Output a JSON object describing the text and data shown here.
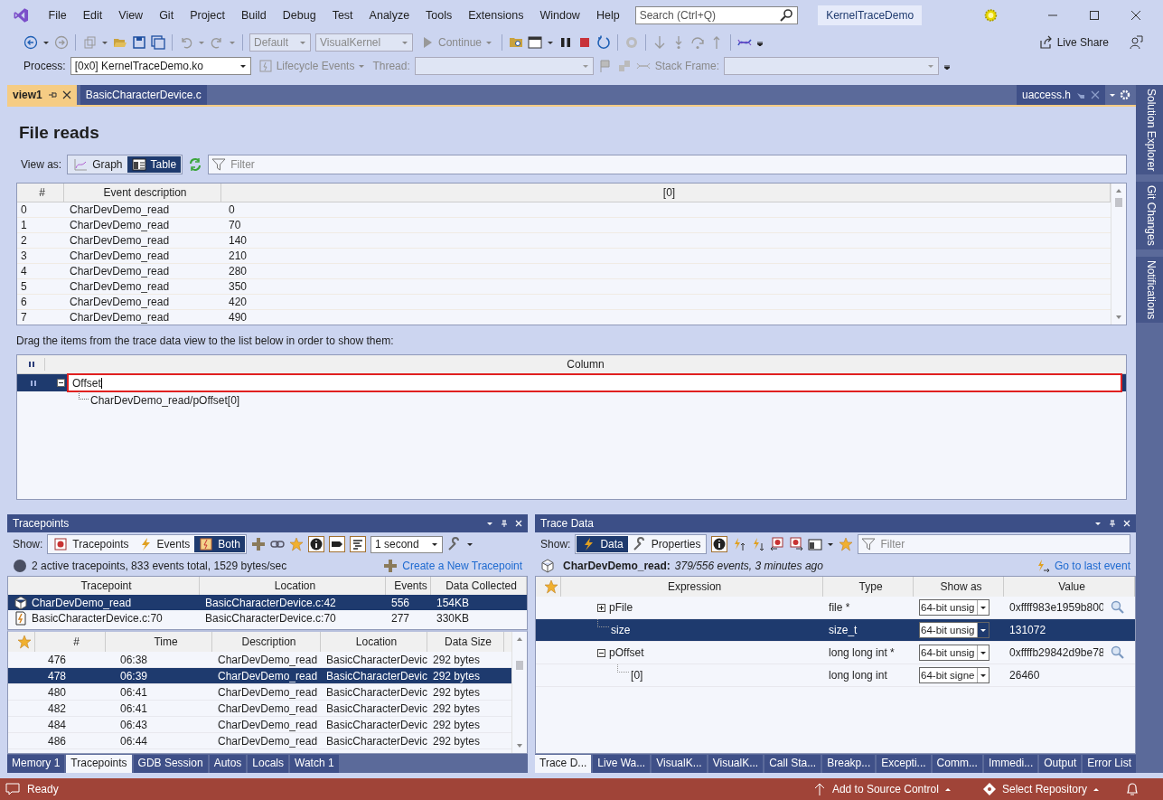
{
  "menu": [
    "File",
    "Edit",
    "View",
    "Git",
    "Project",
    "Build",
    "Debug",
    "Test",
    "Analyze",
    "Tools",
    "Extensions",
    "Window",
    "Help"
  ],
  "search": {
    "placeholder": "Search (Ctrl+Q)"
  },
  "solution_name": "KernelTraceDemo",
  "toolbar": {
    "config": "Default",
    "platform": "VisualKernel",
    "continue": "Continue",
    "live_share": "Live Share"
  },
  "debug_bar": {
    "process_label": "Process:",
    "process": "[0x0] KernelTraceDemo.ko",
    "lifecycle": "Lifecycle Events",
    "thread_label": "Thread:",
    "stack_label": "Stack Frame:"
  },
  "doc_tabs": [
    {
      "label": "view1",
      "selected": true
    },
    {
      "label": "BasicCharacterDevice.c",
      "selected": false
    }
  ],
  "right_tab": "uaccess.h",
  "side_tabs": [
    "Solution Explorer",
    "Git Changes",
    "Notifications"
  ],
  "view": {
    "title": "File reads",
    "view_as_label": "View as:",
    "modes": [
      {
        "label": "Graph",
        "selected": false
      },
      {
        "label": "Table",
        "selected": true
      }
    ],
    "filter_placeholder": "Filter",
    "table": {
      "columns": [
        "#",
        "Event description",
        "[0]"
      ],
      "rows": [
        [
          "0",
          "CharDevDemo_read",
          "0"
        ],
        [
          "1",
          "CharDevDemo_read",
          "70"
        ],
        [
          "2",
          "CharDevDemo_read",
          "140"
        ],
        [
          "3",
          "CharDevDemo_read",
          "210"
        ],
        [
          "4",
          "CharDevDemo_read",
          "280"
        ],
        [
          "5",
          "CharDevDemo_read",
          "350"
        ],
        [
          "6",
          "CharDevDemo_read",
          "420"
        ],
        [
          "7",
          "CharDevDemo_read",
          "490"
        ]
      ]
    },
    "hint": "Drag the items from the trace data view to the list below in order to show them:",
    "column_list": {
      "header": "Column",
      "items": [
        {
          "name": "Offset",
          "expanded": true,
          "children": [
            {
              "name": "CharDevDemo_read/pOffset[0]"
            }
          ]
        }
      ]
    }
  },
  "tracepoints": {
    "title": "Tracepoints",
    "show_label": "Show:",
    "filters": [
      {
        "label": "Tracepoints",
        "selected": false
      },
      {
        "label": "Events",
        "selected": false
      },
      {
        "label": "Both",
        "selected": true
      }
    ],
    "interval": "1 second",
    "summary": "2 active tracepoints, 833 events total, 1529 bytes/sec",
    "create_link": "Create a New Tracepoint",
    "columns": [
      "Tracepoint",
      "Location",
      "Events",
      "Data Collected"
    ],
    "rows": [
      {
        "kind": "function",
        "selected": true,
        "cells": [
          "CharDevDemo_read",
          "BasicCharacterDevice.c:42",
          "556",
          "154KB"
        ]
      },
      {
        "kind": "line",
        "selected": false,
        "cells": [
          "BasicCharacterDevice.c:70",
          "BasicCharacterDevice.c:70",
          "277",
          "330KB"
        ]
      }
    ],
    "events": {
      "columns": [
        "#",
        "Time",
        "Description",
        "Location",
        "Data Size"
      ],
      "rows": [
        {
          "selected": false,
          "cells": [
            "476",
            "06:38",
            "CharDevDemo_read",
            "BasicCharacterDevic",
            "292 bytes"
          ]
        },
        {
          "selected": true,
          "cells": [
            "478",
            "06:39",
            "CharDevDemo_read",
            "BasicCharacterDevic",
            "292 bytes"
          ]
        },
        {
          "selected": false,
          "cells": [
            "480",
            "06:41",
            "CharDevDemo_read",
            "BasicCharacterDevic",
            "292 bytes"
          ]
        },
        {
          "selected": false,
          "cells": [
            "482",
            "06:41",
            "CharDevDemo_read",
            "BasicCharacterDevic",
            "292 bytes"
          ]
        },
        {
          "selected": false,
          "cells": [
            "484",
            "06:43",
            "CharDevDemo_read",
            "BasicCharacterDevic",
            "292 bytes"
          ]
        },
        {
          "selected": false,
          "cells": [
            "486",
            "06:44",
            "CharDevDemo_read",
            "BasicCharacterDevic",
            "292 bytes"
          ]
        }
      ]
    }
  },
  "bottom_left_tabs": [
    {
      "label": "Memory 1",
      "selected": false
    },
    {
      "label": "Tracepoints",
      "selected": true
    },
    {
      "label": "GDB Session",
      "selected": false
    },
    {
      "label": "Autos",
      "selected": false
    },
    {
      "label": "Locals",
      "selected": false
    },
    {
      "label": "Watch 1",
      "selected": false
    }
  ],
  "trace_data": {
    "title": "Trace Data",
    "show_label": "Show:",
    "modes": [
      {
        "label": "Data",
        "selected": true
      },
      {
        "label": "Properties",
        "selected": false
      }
    ],
    "filter_placeholder": "Filter",
    "event_name": "CharDevDemo_read:",
    "event_info": "379/556 events, 3 minutes ago",
    "last_event_link": "Go to last event",
    "columns": [
      "Expression",
      "Type",
      "Show as",
      "Value"
    ],
    "rows": [
      {
        "expression": "pFile",
        "kind": "expandable",
        "expanded": false,
        "selected": false,
        "type": "file *",
        "show_as": "64-bit unsig",
        "value": "0xffff983e1959b800",
        "inspect": true
      },
      {
        "expression": "size",
        "kind": "leaf",
        "selected": true,
        "type": "size_t",
        "show_as": "64-bit unsig",
        "value": "131072",
        "inspect": false
      },
      {
        "expression": "pOffset",
        "kind": "expandable",
        "expanded": true,
        "selected": false,
        "type": "long long int *",
        "show_as": "64-bit unsig",
        "value": "0xffffb29842d9be78",
        "inspect": true,
        "children": [
          {
            "expression": "[0]",
            "kind": "leaf",
            "selected": false,
            "type": "long long int",
            "show_as": "64-bit signe",
            "value": "26460",
            "inspect": false
          }
        ]
      }
    ]
  },
  "bottom_right_tabs": [
    {
      "label": "Trace D...",
      "selected": true
    },
    {
      "label": "Live Wa...",
      "selected": false
    },
    {
      "label": "VisualK...",
      "selected": false
    },
    {
      "label": "VisualK...",
      "selected": false
    },
    {
      "label": "Call Sta...",
      "selected": false
    },
    {
      "label": "Breakp...",
      "selected": false
    },
    {
      "label": "Excepti...",
      "selected": false
    },
    {
      "label": "Comm...",
      "selected": false
    },
    {
      "label": "Immedi...",
      "selected": false
    },
    {
      "label": "Output",
      "selected": false
    },
    {
      "label": "Error List",
      "selected": false
    }
  ],
  "status": {
    "text": "Ready",
    "source_control": "Add to Source Control",
    "repository": "Select Repository"
  }
}
